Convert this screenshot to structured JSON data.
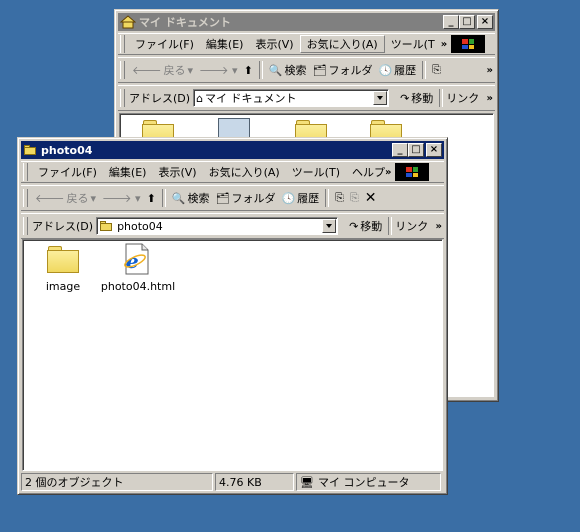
{
  "back_window": {
    "title": "マイ ドキュメント",
    "menu": [
      "ファイル(F)",
      "編集(E)",
      "表示(V)",
      "お気に入り(A)",
      "ツール(T"
    ],
    "toolbar": {
      "back": "戻る",
      "search": "検索",
      "folders": "フォルダ",
      "history": "履歴"
    },
    "address_label": "アドレス(D)",
    "address_value": "マイ ドキュメント",
    "go_label": "移動",
    "links_label": "リンク"
  },
  "front_window": {
    "title": "photo04",
    "menu": [
      "ファイル(F)",
      "編集(E)",
      "表示(V)",
      "お気に入り(A)",
      "ツール(T)",
      "ヘルプ"
    ],
    "toolbar": {
      "back": "戻る",
      "search": "検索",
      "folders": "フォルダ",
      "history": "履歴"
    },
    "address_label": "アドレス(D)",
    "address_value": "photo04",
    "go_label": "移動",
    "links_label": "リンク",
    "files": [
      {
        "name": "image",
        "icon": "folder-icon"
      },
      {
        "name": "photo04.html",
        "icon": "ie-html-icon"
      }
    ],
    "status": {
      "objects": "2 個のオブジェクト",
      "size": "4.76 KB",
      "zone": "マイ コンピュータ"
    }
  },
  "colors": {
    "desktop": "#3a6ea5",
    "active_title": "#0a246a",
    "inactive_title": "#808080",
    "face": "#d4d0c8"
  }
}
